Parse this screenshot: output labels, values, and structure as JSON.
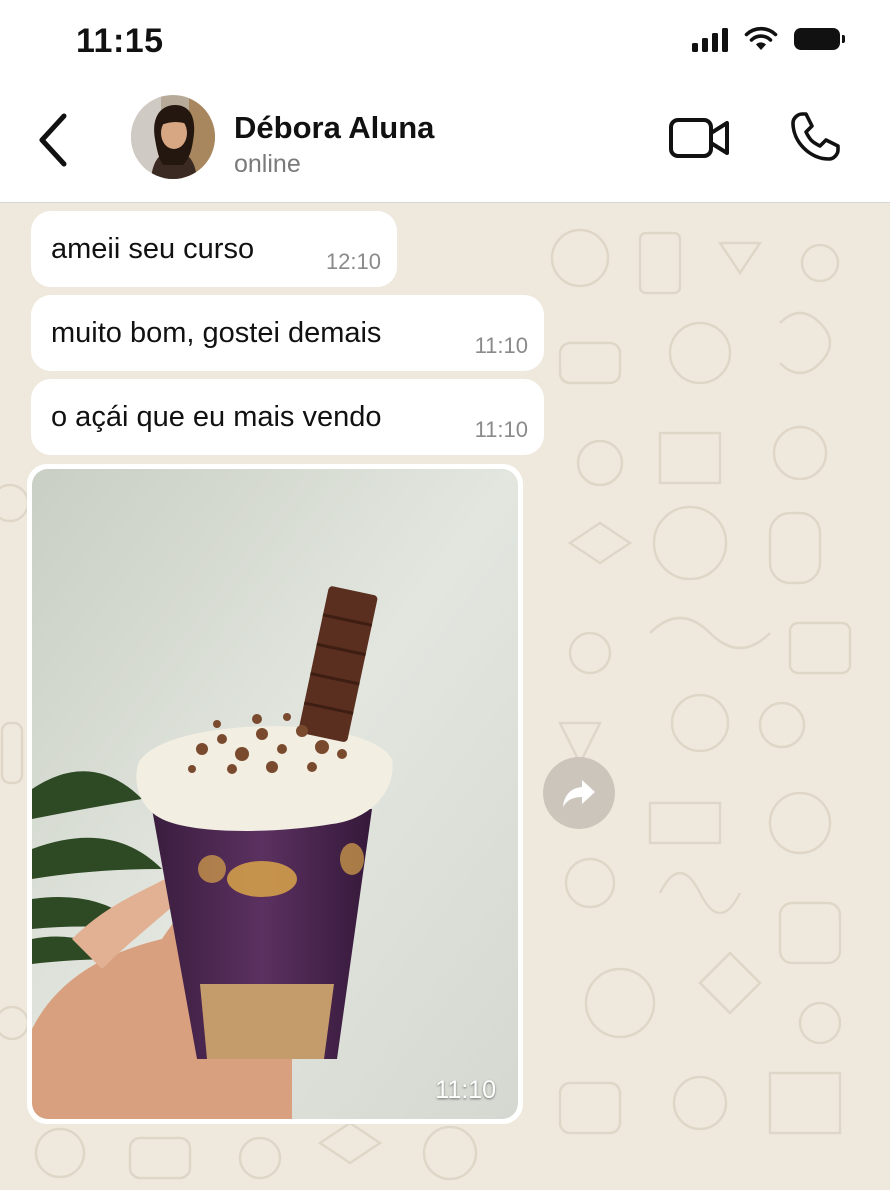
{
  "status_bar": {
    "time": "11:15",
    "icons": [
      "signal-icon",
      "wifi-icon",
      "battery-icon"
    ]
  },
  "header": {
    "back_icon": "chevron-left-icon",
    "contact_name": "Débora Aluna",
    "contact_status": "online",
    "actions": [
      "video-call-icon",
      "phone-icon"
    ]
  },
  "messages": [
    {
      "text": "ameii seu curso",
      "time": "12:10"
    },
    {
      "text": "muito bom, gostei demais",
      "time": "11:10"
    },
    {
      "text": "o açái que eu mais vendo",
      "time": "11:10"
    }
  ],
  "image_message": {
    "time": "11:10",
    "content": "photo-acai-cup"
  },
  "forward_icon": "forward-arrow-icon",
  "colors": {
    "chat_background": "#efe9dd",
    "bubble": "#ffffff",
    "timestamp": "#8a8a8a",
    "forward_button": "#cbc5bb"
  }
}
